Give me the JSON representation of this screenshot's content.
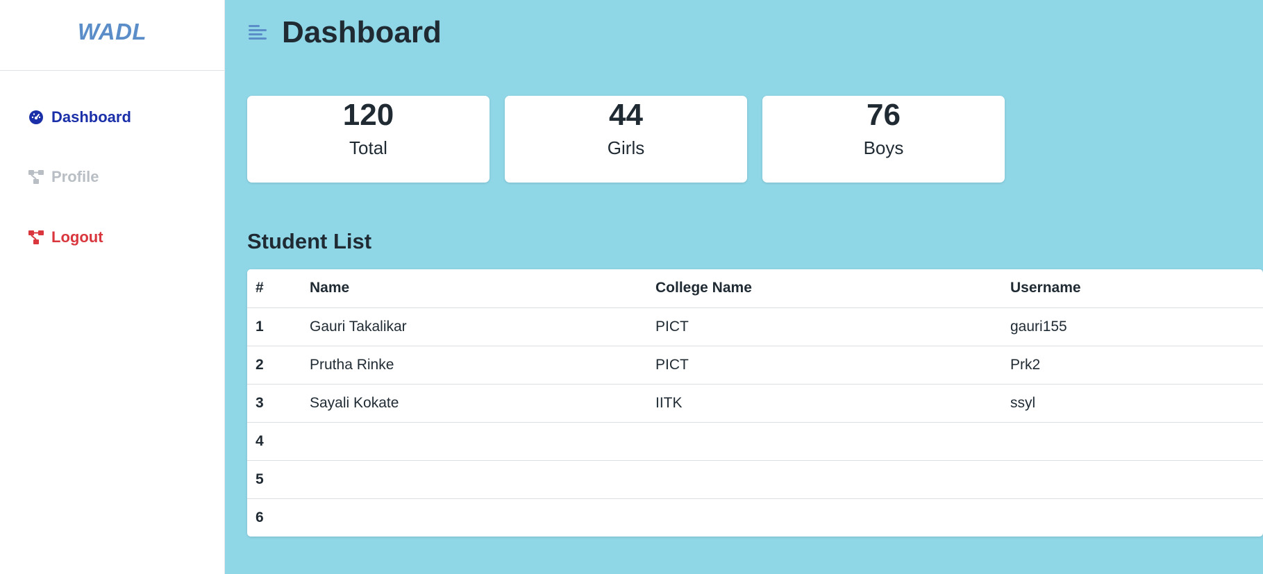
{
  "brand": "WADL",
  "sidebar": {
    "items": [
      {
        "label": "Dashboard",
        "icon": "gauge-icon",
        "color": "#1a2fa8"
      },
      {
        "label": "Profile",
        "icon": "nodes-icon",
        "color": "#b8bec4"
      },
      {
        "label": "Logout",
        "icon": "nodes-icon",
        "color": "#d9363e"
      }
    ]
  },
  "header": {
    "title": "Dashboard",
    "menu_icon": "menu-lines-icon"
  },
  "stats": [
    {
      "value": "120",
      "label": "Total"
    },
    {
      "value": "44",
      "label": "Girls"
    },
    {
      "value": "76",
      "label": "Boys"
    }
  ],
  "student_list": {
    "title": "Student List",
    "columns": [
      "#",
      "Name",
      "College Name",
      "Username"
    ],
    "rows": [
      {
        "num": "1",
        "name": "Gauri Takalikar",
        "college": "PICT",
        "username": "gauri155"
      },
      {
        "num": "2",
        "name": "Prutha Rinke",
        "college": "PICT",
        "username": "Prk2"
      },
      {
        "num": "3",
        "name": "Sayali Kokate",
        "college": "IITK",
        "username": "ssyl"
      },
      {
        "num": "4",
        "name": "",
        "college": "",
        "username": ""
      },
      {
        "num": "5",
        "name": "",
        "college": "",
        "username": ""
      },
      {
        "num": "6",
        "name": "",
        "college": "",
        "username": ""
      }
    ]
  },
  "colors": {
    "background": "#8fd6e6",
    "brand": "#5b8ec9",
    "accent": "#1a2fa8",
    "danger": "#d9363e"
  }
}
